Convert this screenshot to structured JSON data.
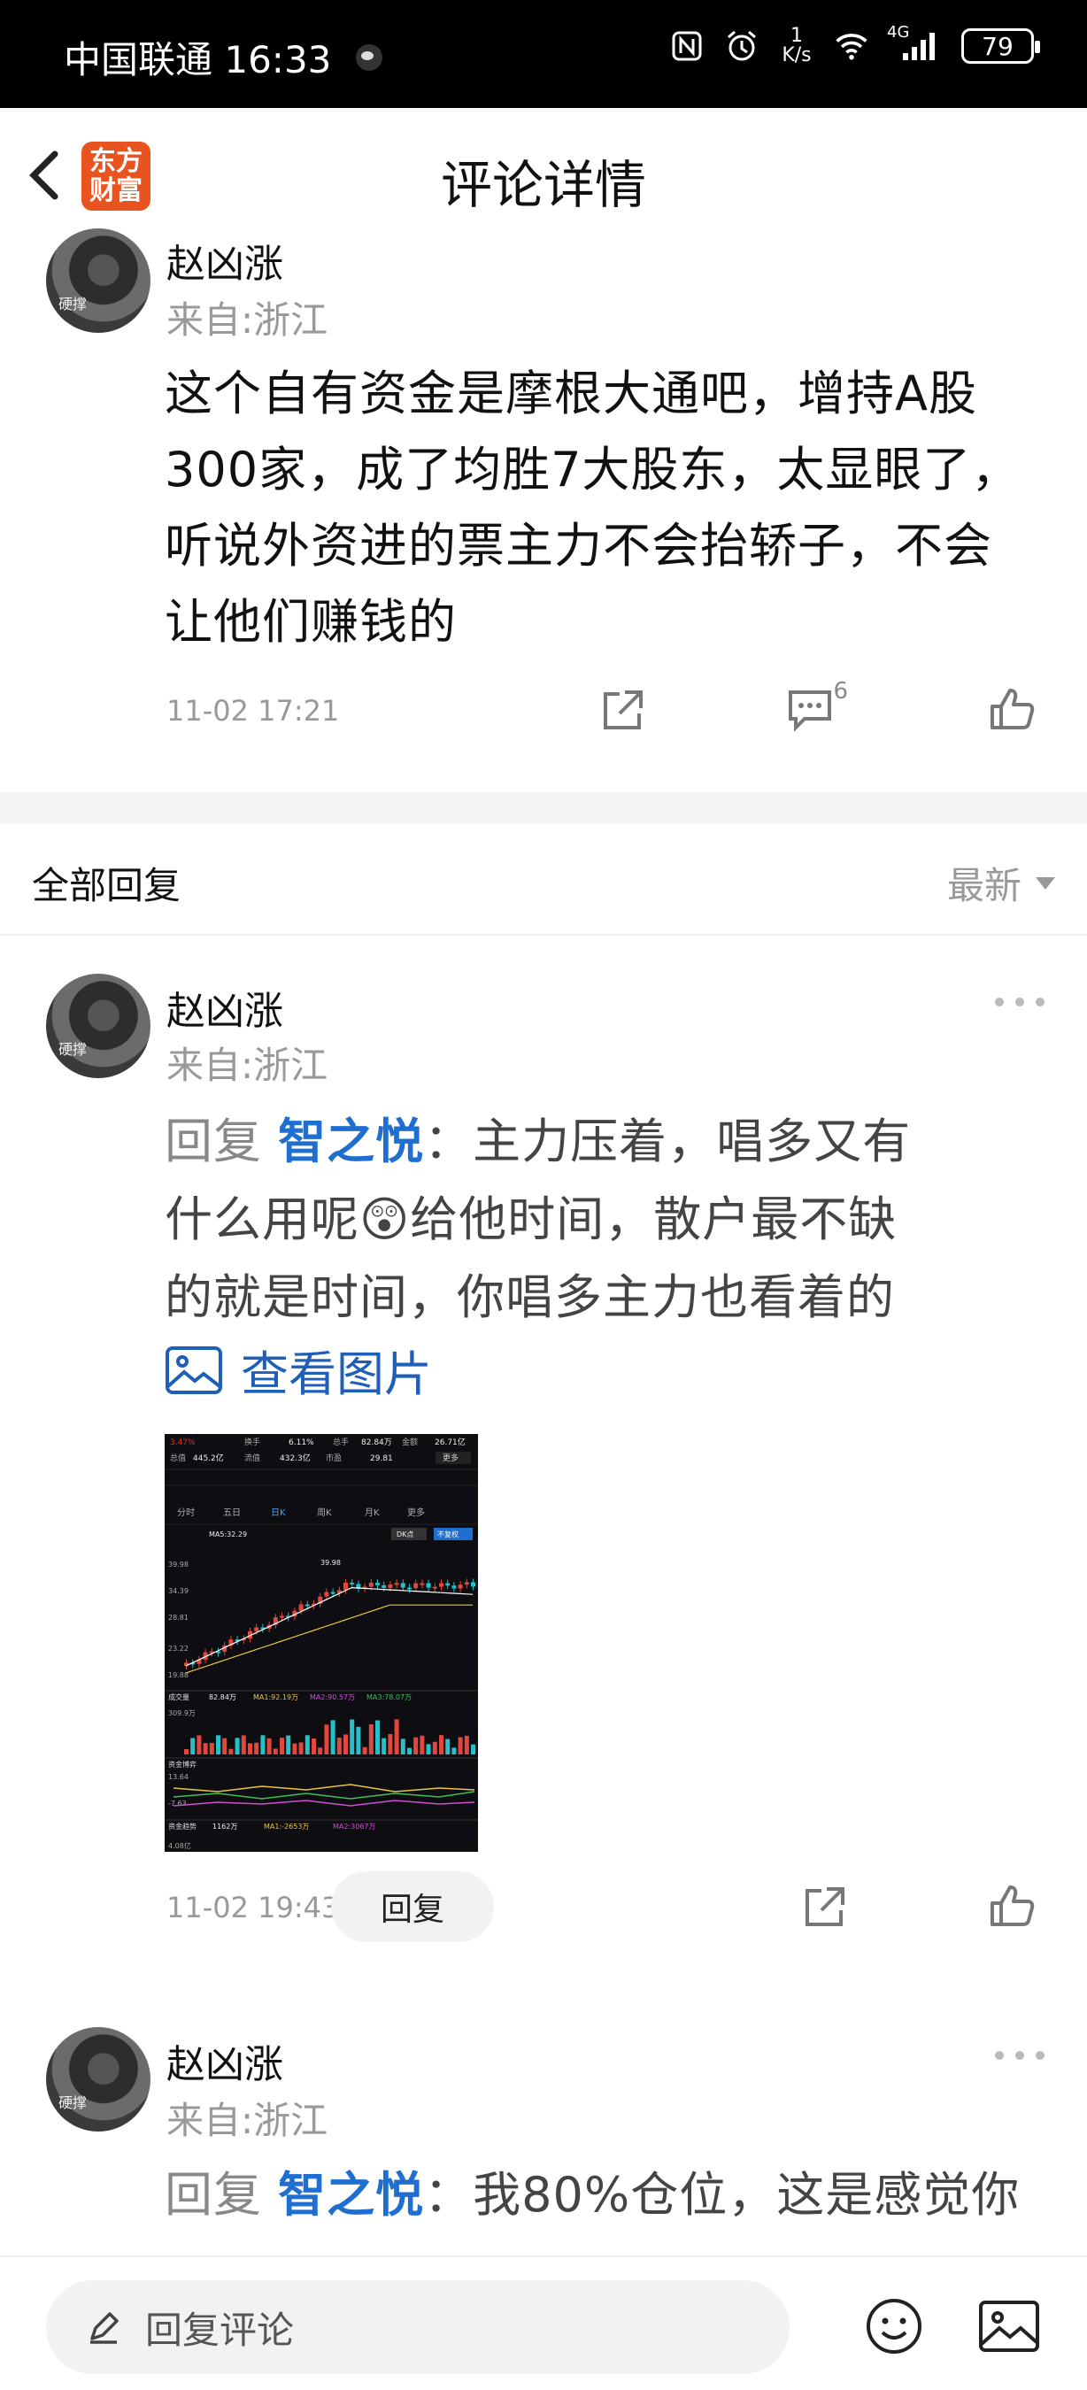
{
  "status_bar": {
    "carrier_time": "中国联通 16:33",
    "speed_top": "1",
    "speed_unit": "K/s",
    "network": "4G",
    "battery": "79"
  },
  "header": {
    "logo_text": "东方财富",
    "title": "评论详情"
  },
  "main_comment": {
    "username": "赵凶涨",
    "from": "来自:浙江",
    "text_lines": [
      "这个自有资金是摩根大通吧，增持A股",
      "300家，成了均胜7大股东，太显眼了，",
      "听说外资进的票主力不会抬轿子，不会",
      "让他们赚钱的"
    ],
    "time": "11-02 17:21",
    "comment_count": "6",
    "avatar_tag": "硬撑"
  },
  "replies_header": {
    "label": "全部回复",
    "sort": "最新"
  },
  "replies": [
    {
      "username": "赵凶涨",
      "from": "来自:浙江",
      "lead": "回复 ",
      "reply_to": "智之悦",
      "lines": [
        "：主力压着，唱多又有",
        "什么用呢😲给他时间，散户最不缺",
        "的就是时间，你唱多主力也看着的"
      ],
      "view_picture": "查看图片",
      "time": "11-02 19:43",
      "reply_button": "回复",
      "avatar_tag": "硬撑"
    },
    {
      "username": "赵凶涨",
      "from": "来自:浙江",
      "lead": "回复 ",
      "reply_to": "智之悦",
      "lines": [
        "：我80%仓位，这是感觉你"
      ],
      "avatar_tag": "硬撑"
    }
  ],
  "thumbnail": {
    "row1": [
      "3.47%",
      "换手",
      "6.11%",
      "总手",
      "82.84万",
      "金额",
      "26.71亿"
    ],
    "row2": [
      "总值",
      "445.2亿",
      "流值",
      "432.3亿",
      "市盈",
      "29.81",
      "更多"
    ],
    "tabs": [
      "分时",
      "五日",
      "日K",
      "周K",
      "月K",
      "更多"
    ],
    "ma_line": "MA5:32.29",
    "price_labels": [
      "39.98",
      "34.39",
      "28.81",
      "23.22",
      "19.88",
      "39.98"
    ],
    "vol_label": "成交量",
    "vol_values": [
      "82.84万",
      "MA1:92.19万",
      "MA2:90.57万",
      "MA3:78.07万"
    ],
    "vol_max": "309.9万",
    "flow_label": "资金博弈",
    "flow_values": [
      "13.64",
      "-7.63"
    ],
    "trend_label": "资金趋势",
    "trend_values": [
      "1162万",
      "MA1:-2653万",
      "MA2:3067万"
    ],
    "trend_bottom": "4.08亿",
    "brand_tag": "DK点",
    "fq_tag": "不复权"
  },
  "bottom_bar": {
    "input_placeholder": "回复评论"
  },
  "colors": {
    "accent_blue": "#1f6fd0",
    "logo_orange": "#e8531f",
    "muted_gray": "#999999"
  }
}
